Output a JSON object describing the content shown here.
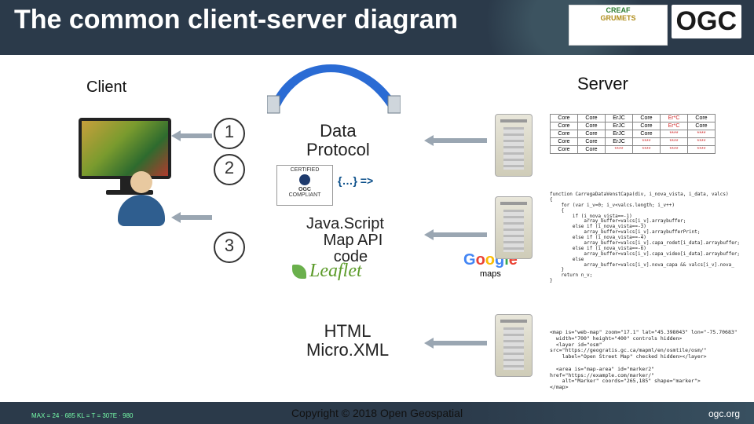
{
  "header": {
    "title": "The common client-server diagram",
    "logos": {
      "creaf": "CREAF",
      "grumets": "GRUMETS"
    },
    "ogc": "OGC"
  },
  "labels": {
    "client": "Client",
    "server": "Server",
    "data_protocol_l1": "Data",
    "data_protocol_l2": "Protocol",
    "ogc_badge_l1": "CERTIFIED",
    "ogc_badge_l2": "OGC",
    "ogc_badge_l3": "COMPLIANT",
    "json_arrow": "{…} =>",
    "jsapi_l1": "Java.Script",
    "jsapi_l2": "Map API",
    "jsapi_l3": "code",
    "leaflet": "Leaflet",
    "google": "Google",
    "google_sub": "maps",
    "html_l1": "HTML",
    "html_l2": "Micro.XML"
  },
  "numbers": {
    "n1": "1",
    "n2": "2",
    "n3": "3"
  },
  "table": {
    "rows": [
      [
        "Core",
        "Core",
        "ErJC",
        "Core",
        "Er*C",
        "Core"
      ],
      [
        "Core",
        "Core",
        "ErJC",
        "Core",
        "Er*C",
        "Core"
      ],
      [
        "Core",
        "Core",
        "ErJC",
        "Core",
        "****",
        "****"
      ],
      [
        "Core",
        "Core",
        "ErJC",
        "****",
        "****",
        "****"
      ],
      [
        "Core",
        "Core",
        "****",
        "****",
        "****",
        "****"
      ]
    ],
    "red_from": [
      [
        2,
        4
      ],
      [
        3,
        3
      ],
      [
        4,
        2
      ]
    ]
  },
  "code": "function CarregaDataVenstCapa(div, i_nova_vista, i_data, valcs)\n{\n    for (var i_v=0; i_v<valcs.length; i_v++)\n    {\n        if (i_nova_vista==-1)\n            array_buffer=valcs[i_v].arraybuffer;\n        else if (i_nova_vista==-3)\n            array_buffer=valcs[i_v].arraybufferPrint;\n        else if (i_nova_vista==-4)\n            array_buffer=valcs[i_v].capa_rodet[i_data].arraybuffer;\n        else if (i_nova_vista==-6)\n            array_buffer=valcs[i_v].capa_video[i_data].arraybuffer;\n        else\n            array_buffer=valcs[i_v].nova_capa && valcs[i_v].nova_\n    }\n    return n_v;\n}",
  "xml": "<map is=\"web-map\" zoom=\"17.1\" lat=\"45.398043\" lon=\"-75.70683\"\n  width=\"700\" height=\"400\" controls hidden>\n  <layer id=\"osm\" src=\"https://geogratis.gc.ca/mapml/en/osmtile/osm/\"\n    label=\"Open Street Map\" checked hidden></layer>\n\n  <area is=\"map-area\" id=\"marker2\" href=\"https://example.com/marker/\"\n    alt=\"Marker\" coords=\"265,185\" shape=\"marker\">\n</map>",
  "footer": {
    "left": "MAX = 24 · 685\nKL = T = 307E · 980",
    "copyright": "Copyright © 2018 Open Geospatial",
    "site": "ogc.org"
  }
}
